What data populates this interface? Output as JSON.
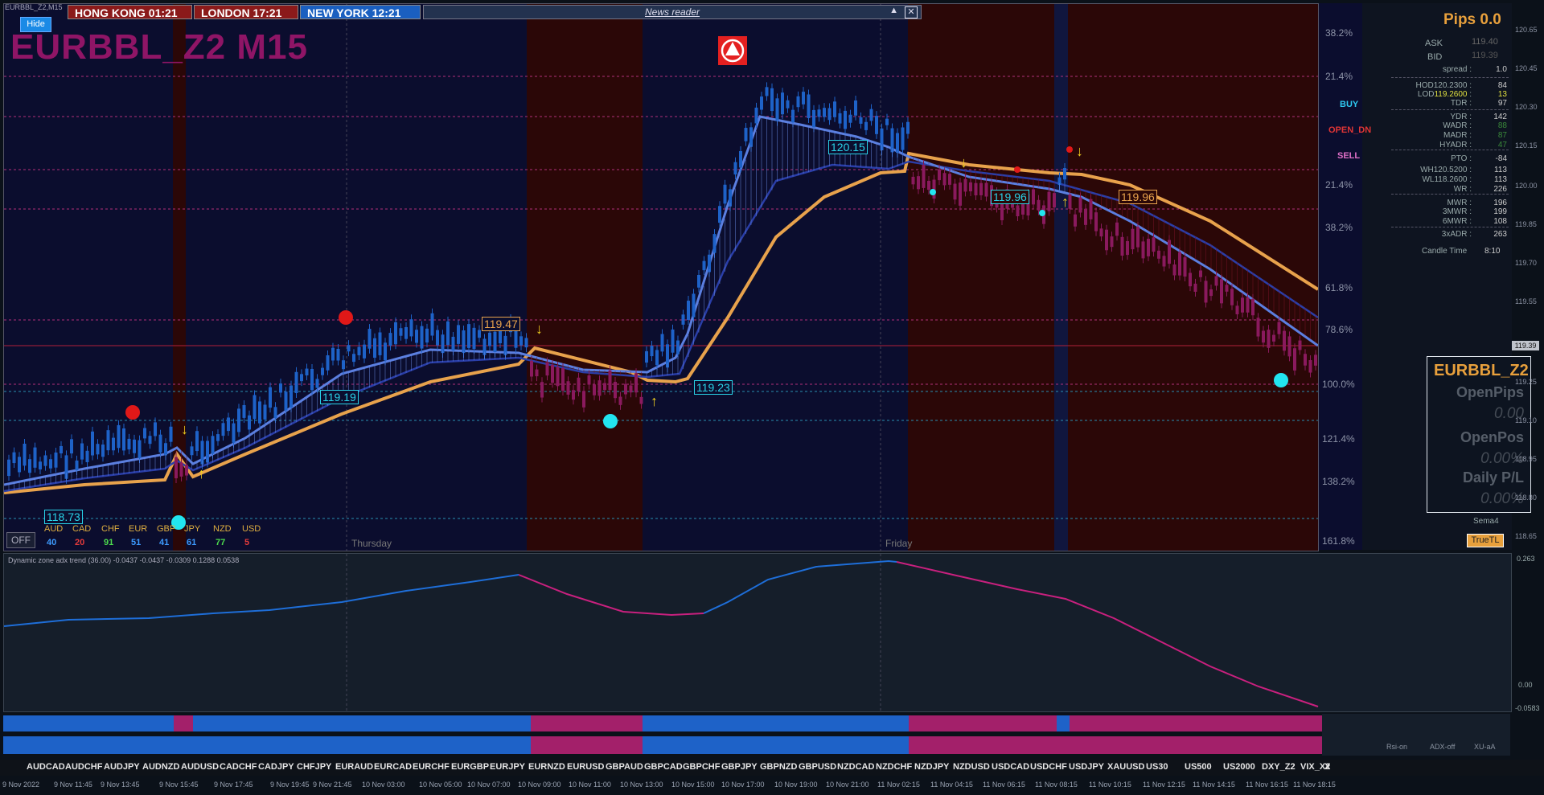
{
  "window": {
    "tab_title": "EURBBL_Z2,M15",
    "chart_title": "EURBBL_Z2 M15",
    "hide_label": "Hide",
    "off_label": "OFF"
  },
  "clocks": [
    {
      "label": "HONG KONG 01:21",
      "color": "#8b1a1a"
    },
    {
      "label": "LONDON  17:21",
      "color": "#8b1a1a"
    },
    {
      "label": "NEW YORK  12:21",
      "color": "#1a5fc0"
    }
  ],
  "news": {
    "label": "News reader",
    "up_icon": "triangle-up",
    "close_icon": "close-box"
  },
  "price_labels": [
    {
      "text": "119.47",
      "kind": "orange"
    },
    {
      "text": "119.19",
      "kind": "cyan"
    },
    {
      "text": "118.73",
      "kind": "cyan"
    },
    {
      "text": "119.23",
      "kind": "cyan"
    },
    {
      "text": "120.15",
      "kind": "cyan"
    },
    {
      "text": "119.96",
      "kind": "cyan"
    },
    {
      "text": "119.96",
      "kind": "orange"
    }
  ],
  "day_labels": [
    "Thursday",
    "Friday"
  ],
  "fib_levels": [
    "38.2%",
    "21.4%",
    "21.4%",
    "38.2%",
    "61.8%",
    "78.6%",
    "100.0%",
    "121.4%",
    "138.2%",
    "161.8%"
  ],
  "currency_strength": {
    "names": [
      "AUD",
      "CAD",
      "CHF",
      "EUR",
      "GBP",
      "JPY",
      "NZD",
      "USD"
    ],
    "values": [
      "40",
      "20",
      "91",
      "51",
      "41",
      "61",
      "77",
      "5"
    ],
    "name_colors": [
      "#e0b040",
      "#e0b040",
      "#e0b040",
      "#e0b040",
      "#e0b040",
      "#e0b040",
      "#e0b040",
      "#e0b040"
    ],
    "value_colors": [
      "#3d9bff",
      "#e53b3b",
      "#4ddc4d",
      "#3d9bff",
      "#3d9bff",
      "#3d9bff",
      "#4ddc4d",
      "#e53b3b"
    ]
  },
  "info_panel": {
    "pips": "Pips 0.0",
    "ask_label": "ASK",
    "ask": "119.40",
    "bid_label": "BID",
    "bid": "119.39",
    "buy": "BUY",
    "open_dn": "OPEN_DN",
    "sell": "SELL",
    "rows": [
      {
        "label": "spread :",
        "value": "1.0"
      },
      {
        "label": "HOD120.2300 :",
        "value": "84"
      },
      {
        "label": "LOD119.2600 :",
        "value": "13"
      },
      {
        "label": "TDR :",
        "value": "97"
      },
      {
        "label": "YDR :",
        "value": "142"
      },
      {
        "label": "WADR :",
        "value": "88"
      },
      {
        "label": "MADR :",
        "value": "87"
      },
      {
        "label": "HYADR :",
        "value": "47"
      },
      {
        "label": "PTO :",
        "value": "-84"
      },
      {
        "label": "WH120.5200 :",
        "value": "113"
      },
      {
        "label": "WL118.2600 :",
        "value": "113"
      },
      {
        "label": "WR :",
        "value": "226"
      },
      {
        "label": "MWR :",
        "value": "196"
      },
      {
        "label": "3MWR :",
        "value": "199"
      },
      {
        "label": "6MWR :",
        "value": "108"
      },
      {
        "label": "3xADR :",
        "value": "263"
      }
    ],
    "candle_time_label": "Candle Time",
    "candle_time": "8:10"
  },
  "trade_box": {
    "symbol": "EURBBL_Z2",
    "open_pips_label": "OpenPips",
    "open_pips": "0.00",
    "open_pos_label": "OpenPos",
    "open_pos": "0.00%",
    "daily_pl_label": "Daily P/L",
    "daily_pl": "0.00%"
  },
  "sema_label": "Sema4",
  "truetl_label": "TrueTL",
  "price_axis": [
    "120.65",
    "120.45",
    "120.30",
    "120.15",
    "120.00",
    "119.85",
    "119.70",
    "119.55",
    "119.39",
    "119.25",
    "119.10",
    "118.95",
    "118.80",
    "118.65"
  ],
  "current_price": "119.39",
  "oscillator": {
    "title": "Dynamic zone adx trend (36.00) -0.0437 -0.0437 -0.0309 0.1288 0.0538",
    "axis": [
      "0.263",
      "0.00",
      "-0.0583"
    ]
  },
  "bottom_labels": [
    "Rsi-on",
    "ADX-off",
    "XU-aA"
  ],
  "symbols": [
    "AUDCAD",
    "AUDCHF",
    "AUDJPY",
    "AUDNZD",
    "AUDUSD",
    "CADCHF",
    "CADJPY",
    "CHFJPY",
    "EURAUD",
    "EURCAD",
    "EURCHF",
    "EURGBP",
    "EURJPY",
    "EURNZD",
    "EURUSD",
    "GBPAUD",
    "GBPCAD",
    "GBPCHF",
    "GBPJPY",
    "GBPNZD",
    "GBPUSD",
    "NZDCAD",
    "NZDCHF",
    "NZDJPY",
    "NZDUSD",
    "USDCAD",
    "USDCHF",
    "USDJPY",
    "XAUUSD",
    "US30",
    "US500",
    "US2000",
    "DXY_Z2",
    "VIX_X2",
    "X"
  ],
  "time_labels": [
    "9 Nov 2022",
    "9 Nov 11:45",
    "9 Nov 13:45",
    "9 Nov 15:45",
    "9 Nov 17:45",
    "9 Nov 19:45",
    "9 Nov 21:45",
    "10 Nov 03:00",
    "10 Nov 05:00",
    "10 Nov 07:00",
    "10 Nov 09:00",
    "10 Nov 11:00",
    "10 Nov 13:00",
    "10 Nov 15:00",
    "10 Nov 17:00",
    "10 Nov 19:00",
    "10 Nov 21:00",
    "11 Nov 02:15",
    "11 Nov 04:15",
    "11 Nov 06:15",
    "11 Nov 08:15",
    "11 Nov 10:15",
    "11 Nov 12:15",
    "11 Nov 14:15",
    "11 Nov 16:15",
    "11 Nov 18:15"
  ],
  "colors": {
    "bull": "#1e62c8",
    "bear": "#8a1a5e",
    "ema_fast": "#5b7fe0",
    "ema_slow": "#e8a24c",
    "bg": "#0b0d2e",
    "session_red": "#2b0707"
  }
}
